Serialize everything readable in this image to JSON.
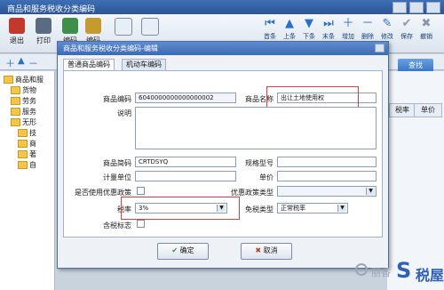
{
  "window": {
    "title": "商品和服务税收分类编码"
  },
  "toolbar": {
    "left": [
      {
        "label": "退出",
        "icon": "exit-icon",
        "color": "#c0392b"
      },
      {
        "label": "打印",
        "icon": "print-icon",
        "color": "#5a6b82"
      },
      {
        "label": "编码",
        "icon": "code-icon",
        "color": "#3f8f4a"
      },
      {
        "label": "编码",
        "icon": "code2-icon",
        "color": "#c59a2e"
      }
    ],
    "right": [
      "首条",
      "上条",
      "下条",
      "末条",
      "增加",
      "删除",
      "修改",
      "保存",
      "撤销"
    ]
  },
  "search": {
    "button_label": "查找"
  },
  "tree": {
    "items": [
      "商品和服",
      "货物",
      "劳务",
      "服务",
      "无形",
      "技",
      "商",
      "著",
      "自"
    ]
  },
  "table": {
    "headers": [
      "税率",
      "单价"
    ]
  },
  "dialog": {
    "title": "商品和服务税收分类编码-编辑",
    "tabs": [
      "普通商品编码",
      "机动车编码"
    ],
    "fields": {
      "product_code_label": "商品编码",
      "product_code_value": "6040000000000000002",
      "product_name_label": "商品名称",
      "product_name_value": "出让土地使用权",
      "description_label": "说明",
      "short_code_label": "商品简码",
      "short_code_value": "CRTDSYQ",
      "spec_label": "规格型号",
      "unit_label": "计量单位",
      "price_label": "单价",
      "preferential_label": "是否使用优惠政策",
      "preferential_type_label": "优惠政策类型",
      "tax_rate_label": "税率",
      "tax_rate_value": "3%",
      "tax_free_type_label": "免税类型",
      "tax_free_type_value": "正常税率",
      "tax_inclusive_label": "含税标志"
    },
    "buttons": {
      "ok": "确定",
      "cancel": "取消"
    }
  },
  "watermark": {
    "text1": "丽香",
    "text2": "税屋"
  }
}
